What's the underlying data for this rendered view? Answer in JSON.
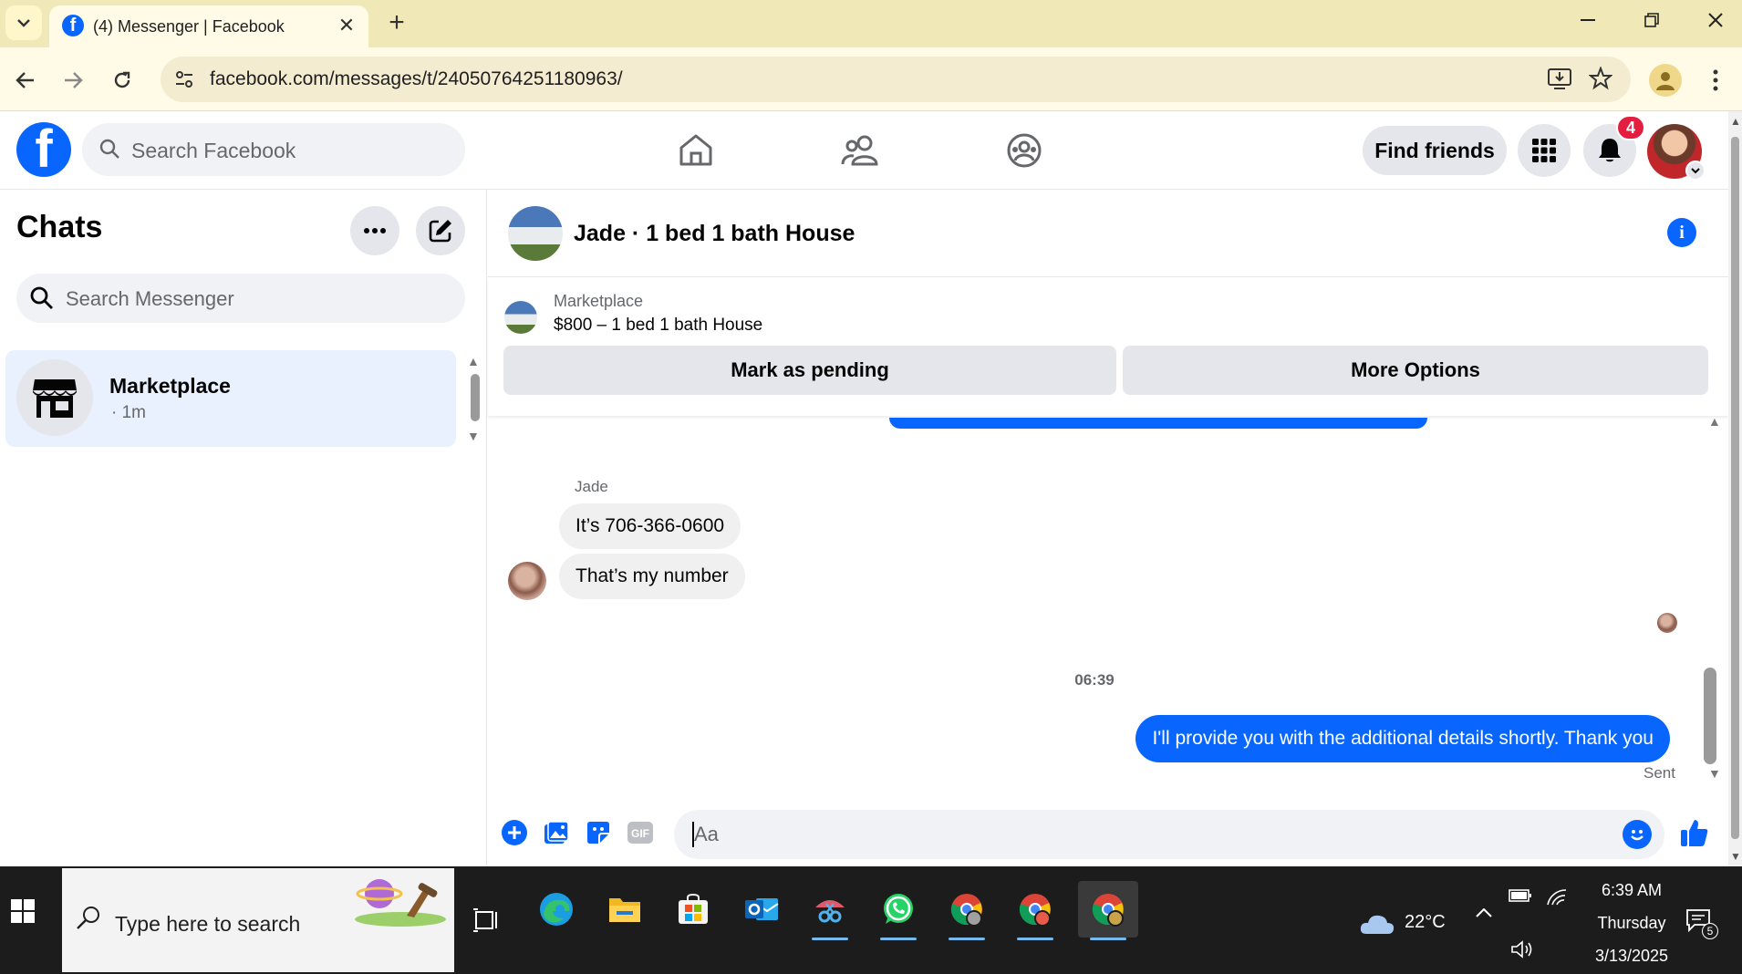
{
  "browser": {
    "tab_title": "(4) Messenger | Facebook",
    "url": "facebook.com/messages/t/24050764251180963/",
    "favicon_letter": "f",
    "new_tab": "+",
    "close_tab": "✕"
  },
  "fb_header": {
    "logo_letter": "f",
    "search_placeholder": "Search Facebook",
    "find_friends_label": "Find friends",
    "notification_count": "4"
  },
  "sidebar": {
    "title": "Chats",
    "more_label": "•••",
    "search_placeholder": "Search Messenger",
    "chats": [
      {
        "name": "Marketplace",
        "time": "· 1m"
      }
    ]
  },
  "conversation": {
    "title": "Jade · 1 bed 1 bath House",
    "info_icon_glyph": "i",
    "marketplace": {
      "label": "Marketplace",
      "listing": "$800 – 1 bed 1 bath House",
      "mark_pending_label": "Mark as pending",
      "more_options_label": "More Options"
    },
    "sender_name": "Jade",
    "incoming_messages": [
      "It’s 706-366-0600",
      "That’s my number"
    ],
    "timestamp": "06:39",
    "outgoing_message": "I'll provide you with the additional details shortly. Thank you",
    "outgoing_status": "Sent",
    "composer_placeholder": "Aa"
  },
  "taskbar": {
    "search_placeholder": "Type here to search",
    "weather_temp": "22°C",
    "time": "6:39 AM",
    "day": "Thursday",
    "date": "3/13/2025",
    "notification_count": "5"
  },
  "colors": {
    "fb_blue": "#0866ff",
    "badge_red": "#e41e3f",
    "chrome_tabbar": "#f1e8b8",
    "chat_selected": "#e8f1fd"
  }
}
